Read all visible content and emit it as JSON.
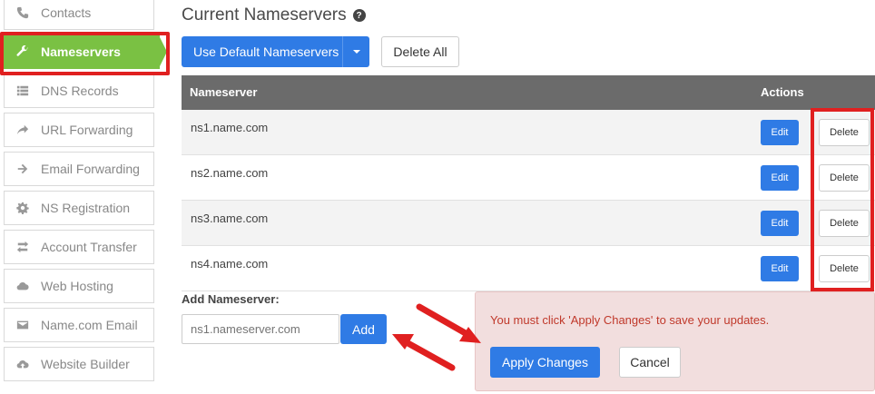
{
  "sidebar": {
    "items": [
      {
        "label": "Contacts",
        "icon": "phone-icon"
      },
      {
        "label": "Nameservers",
        "icon": "wrench-icon",
        "active": true
      },
      {
        "label": "DNS Records",
        "icon": "list-icon"
      },
      {
        "label": "URL Forwarding",
        "icon": "share-arrow-icon"
      },
      {
        "label": "Email Forwarding",
        "icon": "arrow-right-icon"
      },
      {
        "label": "NS Registration",
        "icon": "gear-icon"
      },
      {
        "label": "Account Transfer",
        "icon": "exchange-icon"
      },
      {
        "label": "Web Hosting",
        "icon": "cloud-icon"
      },
      {
        "label": "Name.com Email",
        "icon": "envelope-icon"
      },
      {
        "label": "Website Builder",
        "icon": "cloud-upload-icon"
      }
    ]
  },
  "main": {
    "title": "Current Nameservers",
    "help_glyph": "?",
    "use_default_label": "Use Default Nameservers",
    "delete_all_label": "Delete All",
    "table": {
      "headers": {
        "nameserver": "Nameserver",
        "actions": "Actions"
      },
      "rows": [
        {
          "nameserver": "ns1.name.com",
          "edit": "Edit",
          "delete": "Delete"
        },
        {
          "nameserver": "ns2.name.com",
          "edit": "Edit",
          "delete": "Delete"
        },
        {
          "nameserver": "ns3.name.com",
          "edit": "Edit",
          "delete": "Delete"
        },
        {
          "nameserver": "ns4.name.com",
          "edit": "Edit",
          "delete": "Delete"
        }
      ]
    },
    "add": {
      "label": "Add Nameserver:",
      "placeholder": "ns1.nameserver.com",
      "button": "Add"
    },
    "alert": {
      "message": "You must click 'Apply Changes' to save your updates.",
      "apply_label": "Apply Changes",
      "cancel_label": "Cancel"
    }
  },
  "colors": {
    "accent": "#2f7be5",
    "active_nav": "#7ac143",
    "highlight": "#e02020",
    "alert_bg": "#f2dede",
    "alert_text": "#c0392b",
    "table_header": "#6b6b6b"
  }
}
